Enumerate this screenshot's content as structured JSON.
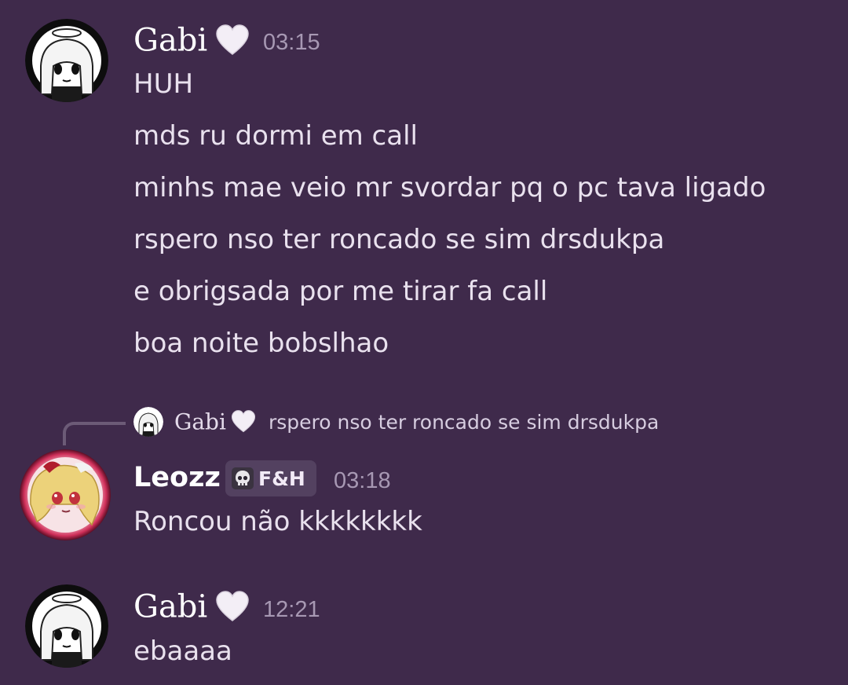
{
  "messages": [
    {
      "author": "Gabi",
      "author_emoji": "white-heart",
      "timestamp": "03:15",
      "lines": [
        "HUH",
        "mds ru dormi em call",
        "minhs mae veio mr svordar pq o pc tava ligado",
        "rspero nso ter roncado se sim drsdukpa",
        "e obrigsada por me tirar fa call",
        "boa noite bobslhao"
      ]
    },
    {
      "reply_to": {
        "author": "Gabi",
        "author_emoji": "white-heart",
        "text": "rspero nso ter roncado se sim drsdukpa"
      },
      "author": "Leozz",
      "tag": {
        "icon": "skull-icon",
        "label": "F&H"
      },
      "timestamp": "03:18",
      "lines": [
        "Roncou não kkkkkkkk"
      ]
    },
    {
      "author": "Gabi",
      "author_emoji": "white-heart",
      "timestamp": "12:21",
      "lines": [
        "ebaaaa"
      ]
    }
  ],
  "colors": {
    "background": "#3f2a4b",
    "text": "#e9e1ee",
    "timestamp": "#a798b3",
    "tag_background": "#534160"
  }
}
